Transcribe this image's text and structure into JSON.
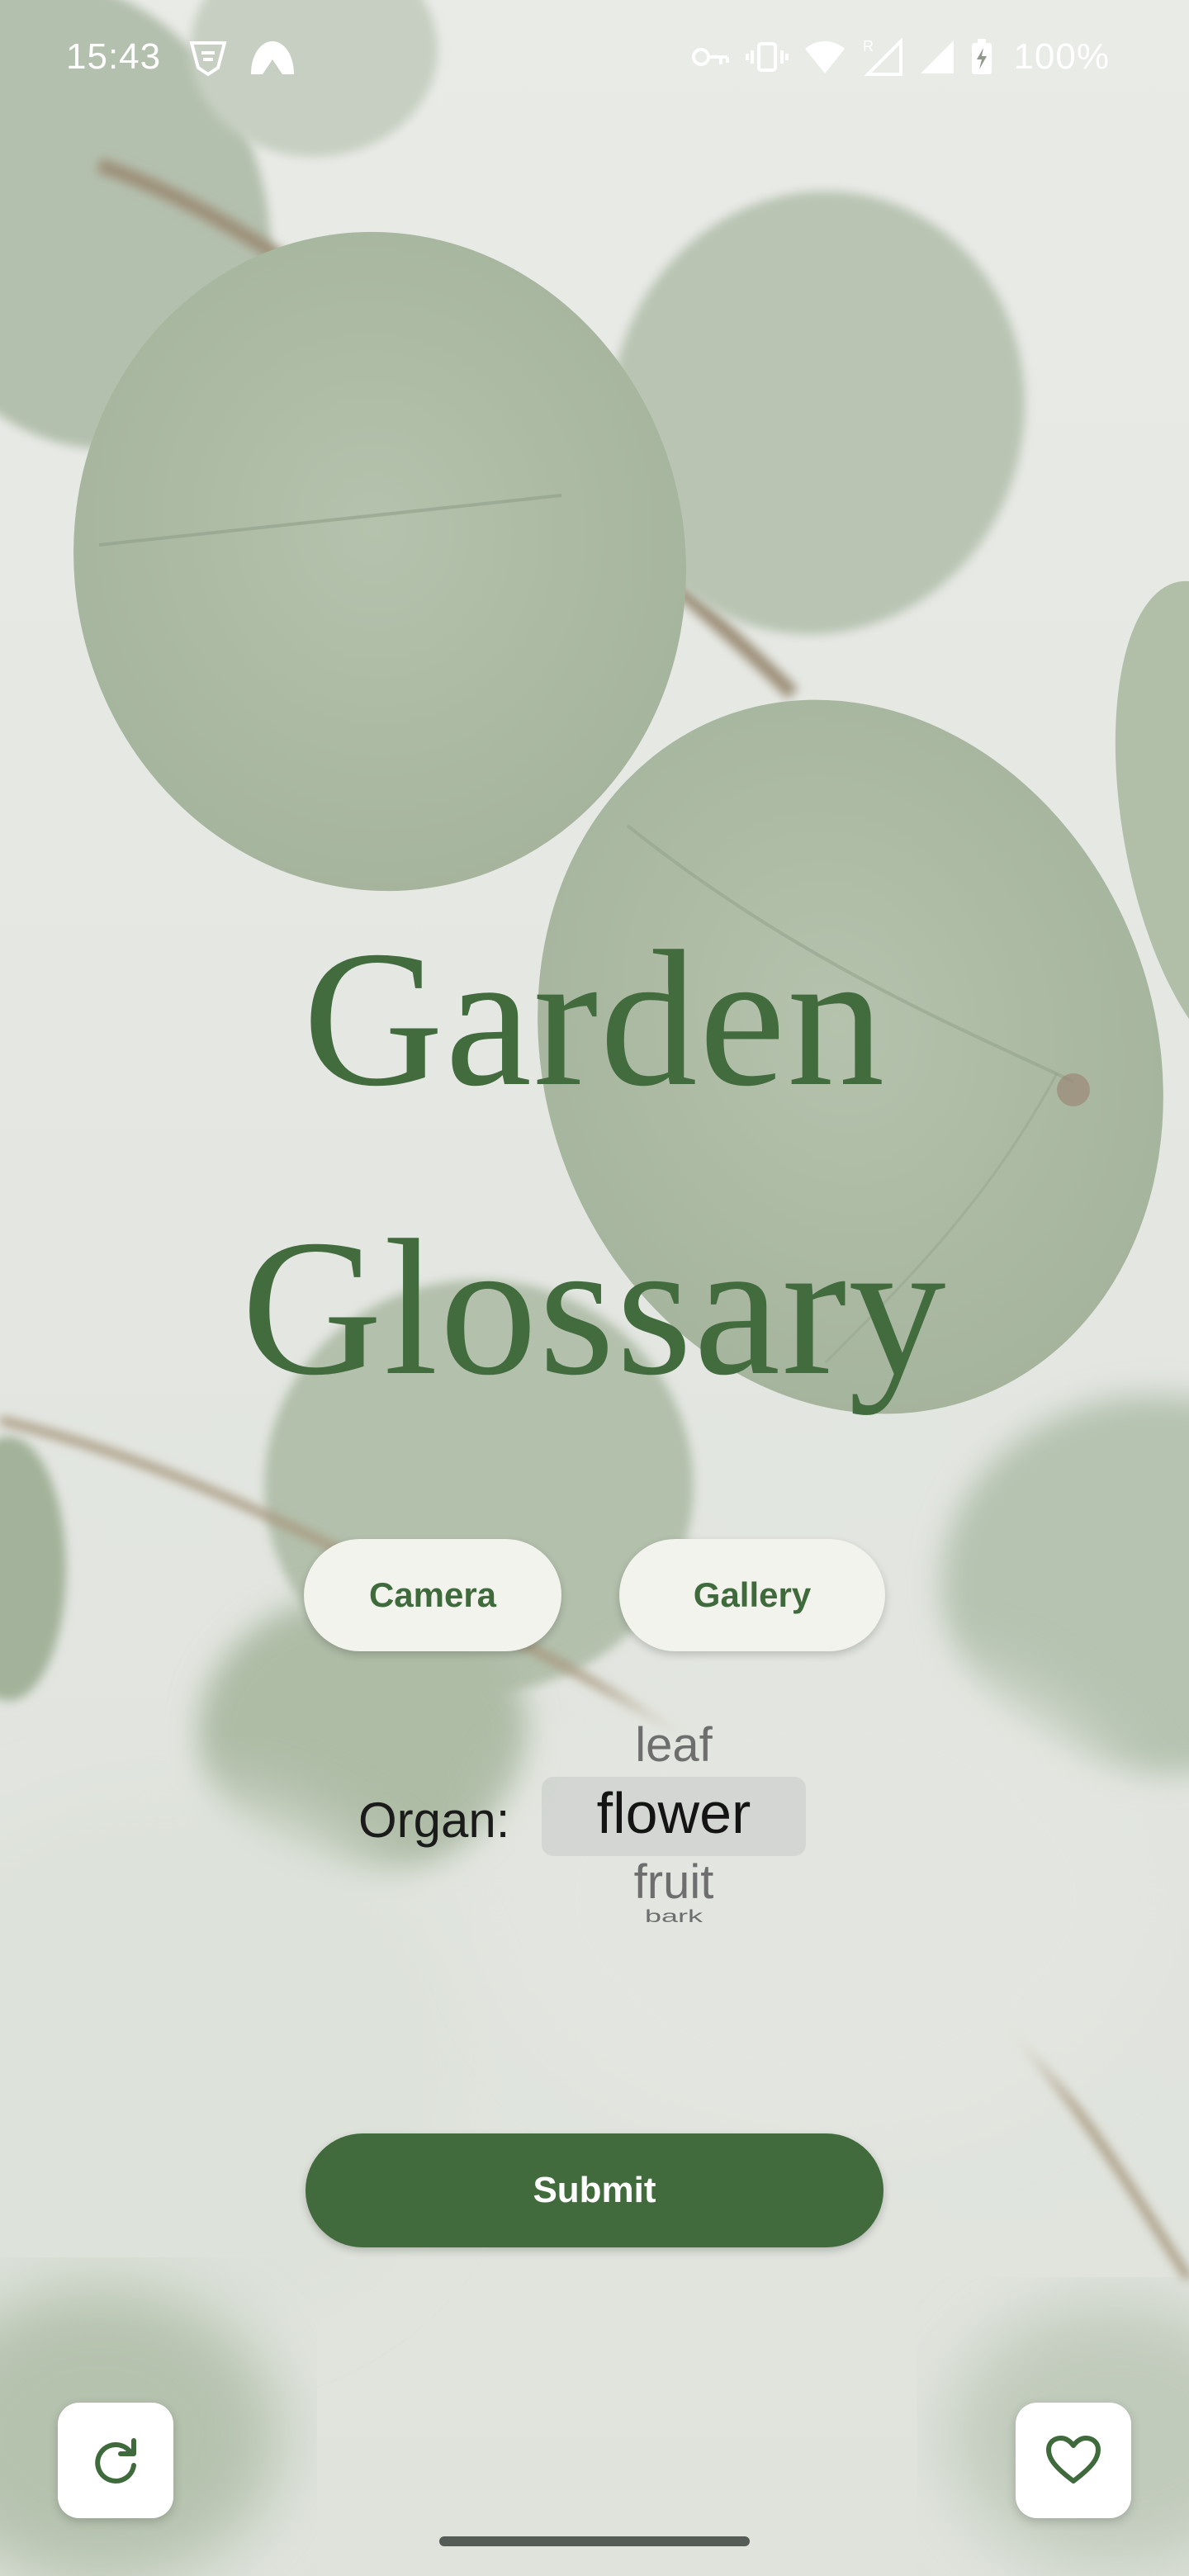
{
  "status_bar": {
    "time": "15:43",
    "battery_text": "100%",
    "left_icons": [
      "vpn-shield-icon",
      "cloud-mountain-icon"
    ],
    "right_icons": [
      "key-icon",
      "vibrate-icon",
      "wifi-icon",
      "signal-r-icon",
      "signal-icon",
      "battery-charging-icon"
    ]
  },
  "title": {
    "line1": "Garden",
    "line2": "Glossary"
  },
  "buttons": {
    "camera_label": "Camera",
    "gallery_label": "Gallery",
    "submit_label": "Submit"
  },
  "organ_picker": {
    "label": "Organ:",
    "options": [
      "leaf",
      "flower",
      "fruit",
      "bark"
    ],
    "selected": "flower"
  },
  "corner_buttons": {
    "left_icon": "refresh-icon",
    "right_icon": "heart-icon"
  },
  "colors": {
    "accent_green": "#426b3e",
    "pill_background": "#f1f3ec",
    "background": "#e4e7e2"
  }
}
